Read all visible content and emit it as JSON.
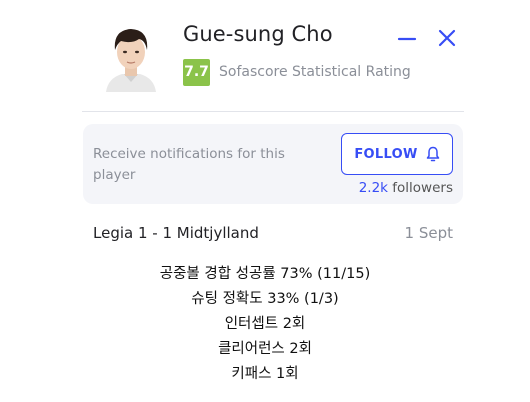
{
  "player": {
    "name": "Gue-sung Cho",
    "rating": "7.7",
    "rating_label": "Sofascore Statistical Rating",
    "rating_color": "#8bc34a"
  },
  "header_actions": {
    "minimize_icon": "minimize-icon",
    "close_icon": "close-icon"
  },
  "notifications": {
    "text": "Receive notifications for this player",
    "follow_label": "FOLLOW",
    "follow_icon": "bell-icon",
    "followers_count": "2.2k",
    "followers_label": "followers",
    "accent_color": "#374df5"
  },
  "match": {
    "name": "Legia 1 - 1 Midtjylland",
    "date": "1 Sept"
  },
  "stats": [
    "공중볼 경합 성공률 73% (11/15)",
    "슈팅 정확도 33% (1/3)",
    "인터셉트 2회",
    "클리어런스 2회",
    "키패스 1회"
  ]
}
